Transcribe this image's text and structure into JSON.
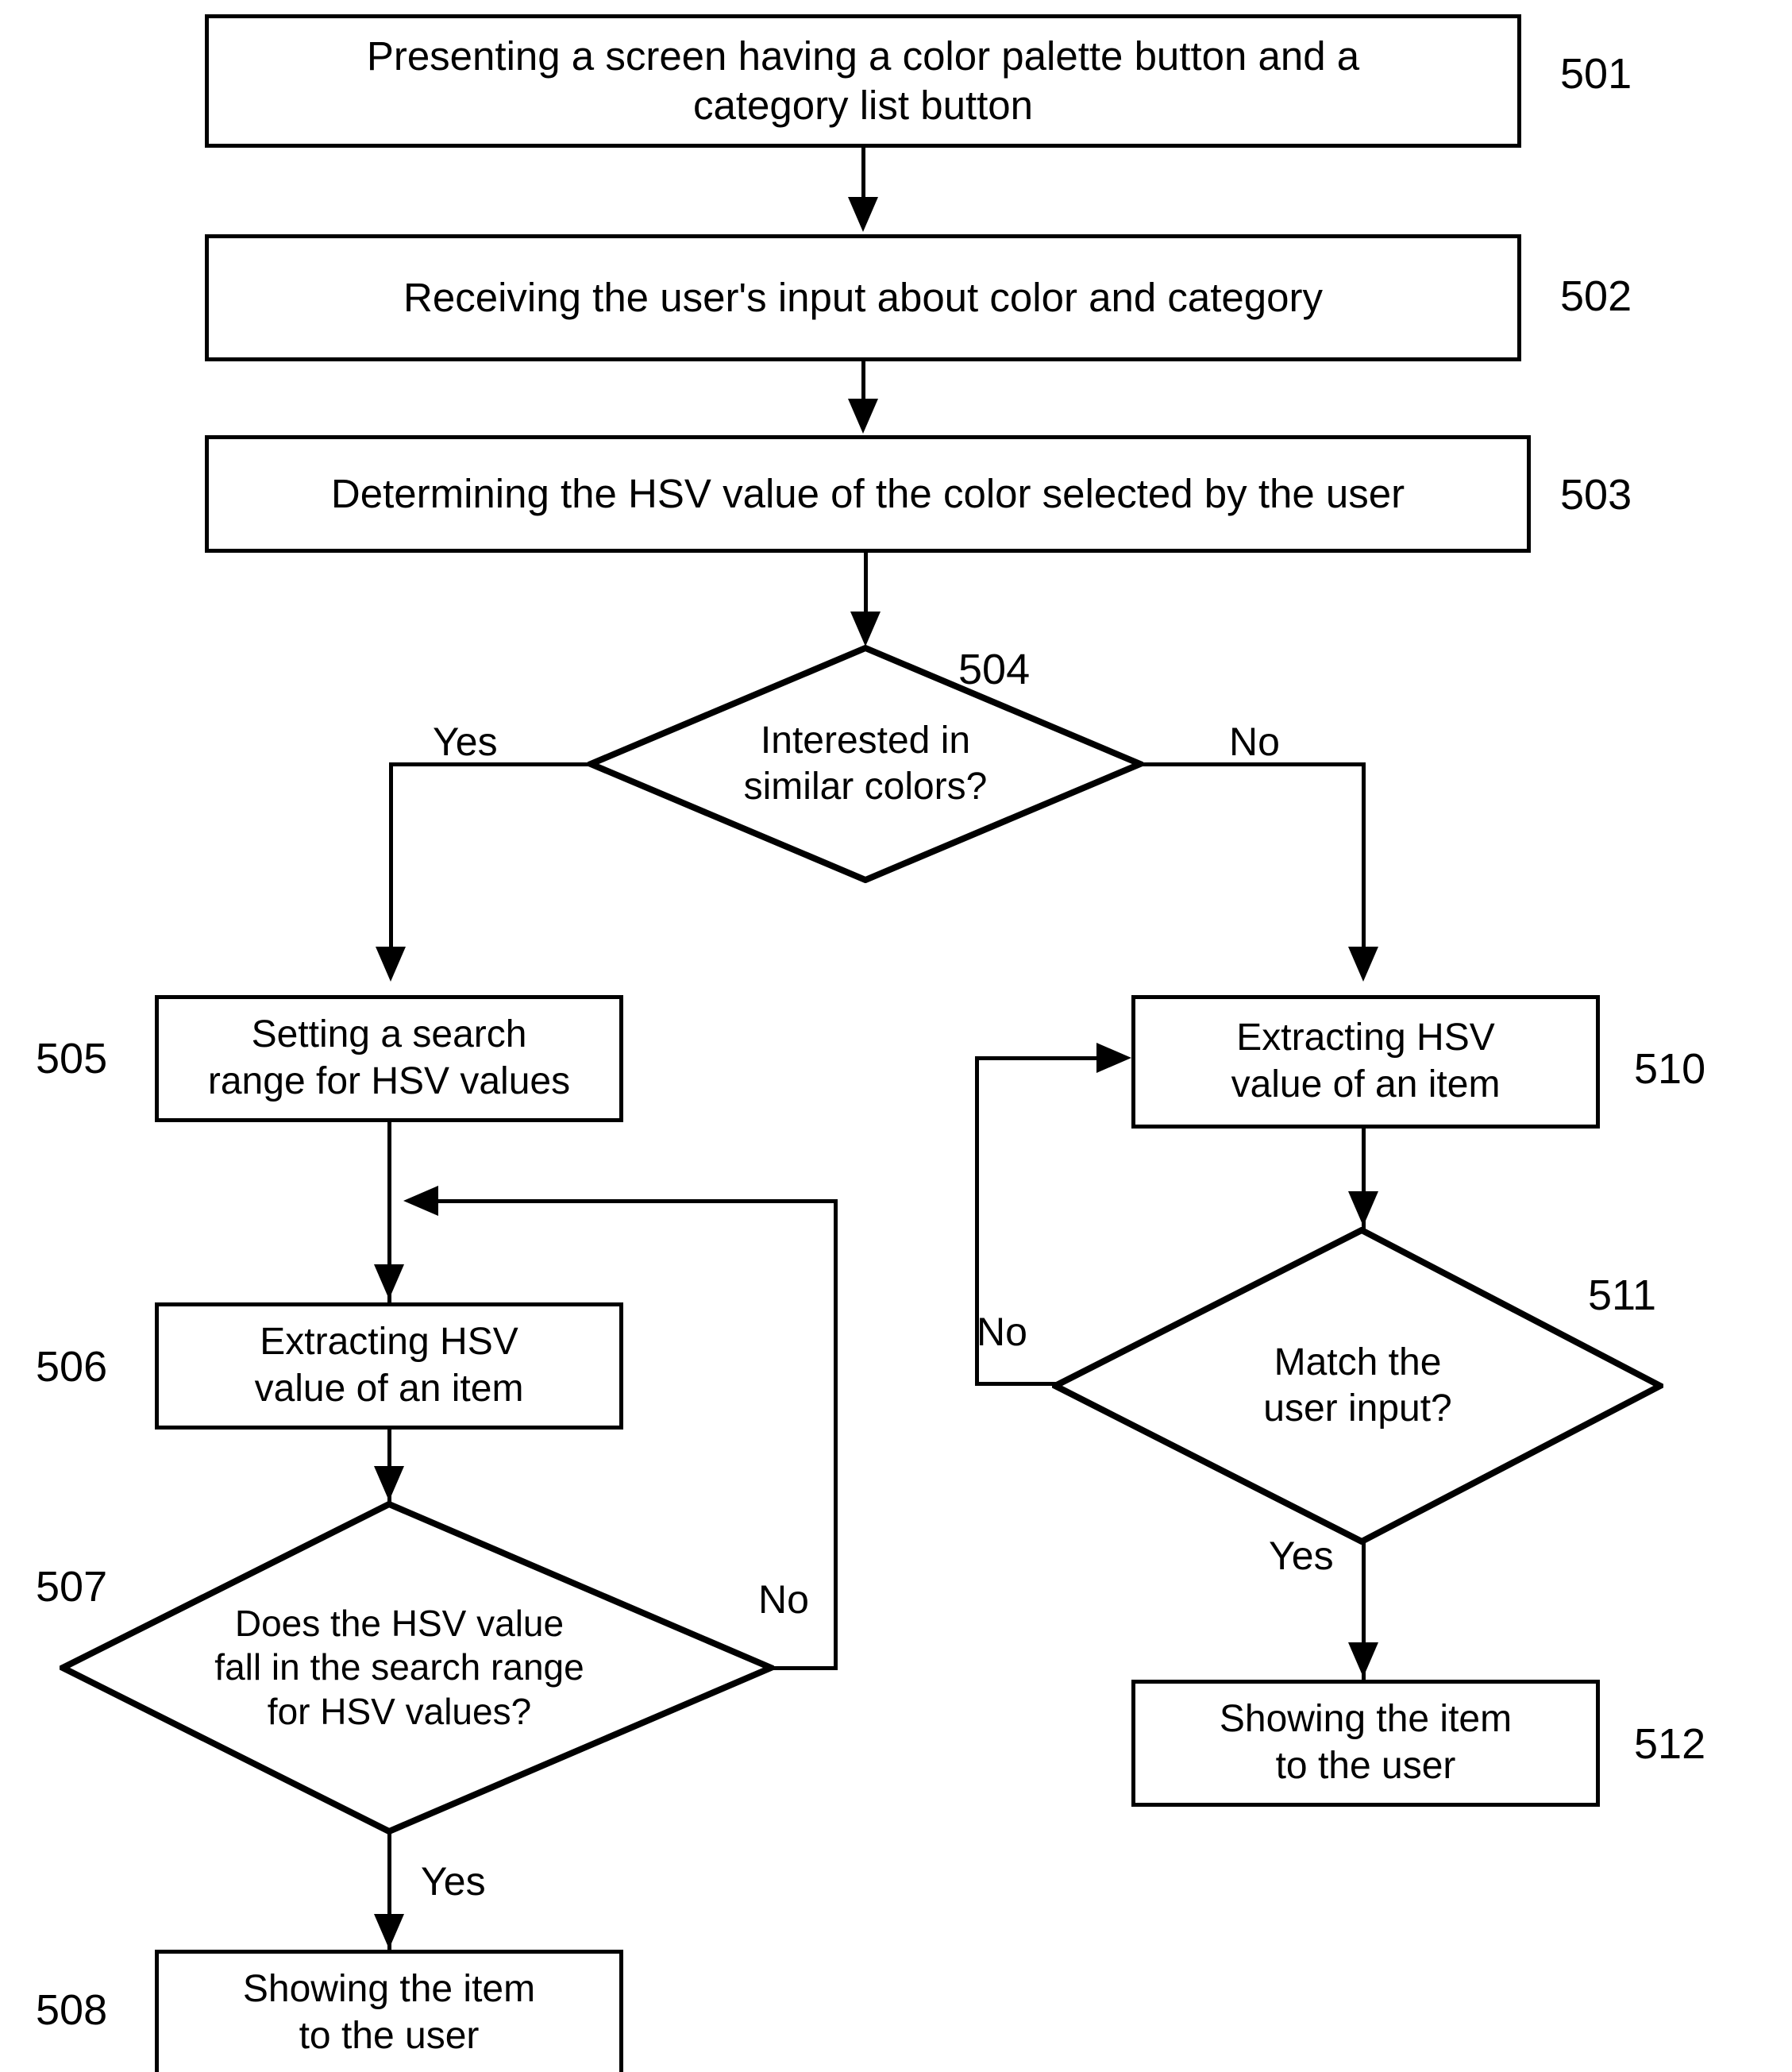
{
  "diagram": {
    "type": "flowchart",
    "figure_label": "",
    "nodes": [
      {
        "id": "501",
        "shape": "process",
        "ref": "501",
        "text": "Presenting a screen having a color palette button and a\ncategory list button"
      },
      {
        "id": "502",
        "shape": "process",
        "ref": "502",
        "text": "Receiving the user's input about color and category"
      },
      {
        "id": "503",
        "shape": "process",
        "ref": "503",
        "text": "Determining the HSV value of the color selected by the user"
      },
      {
        "id": "504",
        "shape": "decision",
        "ref": "504",
        "text": "Interested in\nsimilar colors?"
      },
      {
        "id": "505",
        "shape": "process",
        "ref": "505",
        "text": "Setting  a search\nrange for HSV values"
      },
      {
        "id": "506",
        "shape": "process",
        "ref": "506",
        "text": "Extracting  HSV\nvalue of an item"
      },
      {
        "id": "507",
        "shape": "decision",
        "ref": "507",
        "text": "Does the HSV value\nfall in the search range\nfor HSV values?"
      },
      {
        "id": "508",
        "shape": "process",
        "ref": "508",
        "text": "Showing the item\nto the user"
      },
      {
        "id": "510",
        "shape": "process",
        "ref": "510",
        "text": "Extracting HSV\nvalue of an item"
      },
      {
        "id": "511",
        "shape": "decision",
        "ref": "511",
        "text": "Match the\nuser input?"
      },
      {
        "id": "512",
        "shape": "process",
        "ref": "512",
        "text": "Showing the item\nto the user"
      }
    ],
    "edges": [
      {
        "from": "501",
        "to": "502",
        "label": ""
      },
      {
        "from": "502",
        "to": "503",
        "label": ""
      },
      {
        "from": "503",
        "to": "504",
        "label": ""
      },
      {
        "from": "504",
        "to": "505",
        "label": "Yes"
      },
      {
        "from": "504",
        "to": "510",
        "label": "No"
      },
      {
        "from": "505",
        "to": "506",
        "label": ""
      },
      {
        "from": "506",
        "to": "507",
        "label": ""
      },
      {
        "from": "507",
        "to": "508",
        "label": "Yes"
      },
      {
        "from": "507",
        "to": "506",
        "label": "No"
      },
      {
        "from": "510",
        "to": "511",
        "label": ""
      },
      {
        "from": "511",
        "to": "512",
        "label": "Yes"
      },
      {
        "from": "511",
        "to": "510",
        "label": "No"
      }
    ],
    "colors": {
      "stroke": "#000000",
      "fill": "#ffffff",
      "text": "#000000"
    }
  }
}
